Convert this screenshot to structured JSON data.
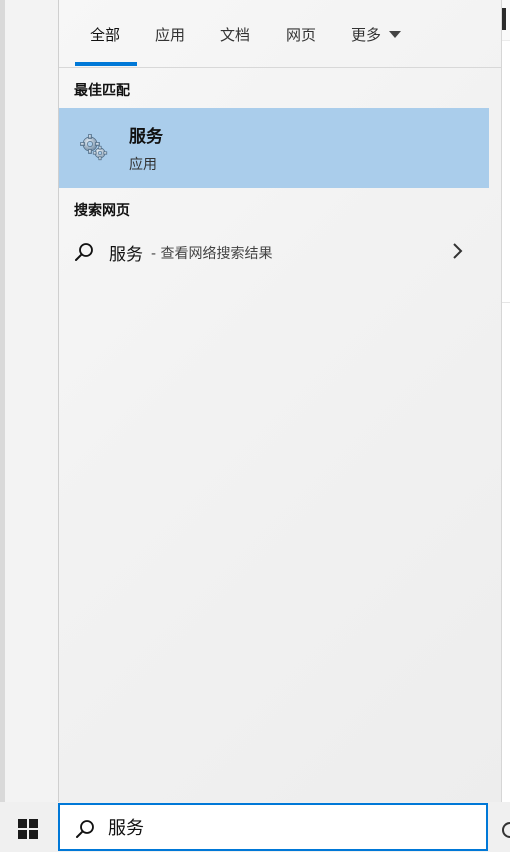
{
  "tabs": [
    {
      "label": "全部"
    },
    {
      "label": "应用"
    },
    {
      "label": "文档"
    },
    {
      "label": "网页"
    },
    {
      "label": "更多"
    }
  ],
  "active_tab": "全部",
  "best_match": {
    "section_label": "最佳匹配",
    "name": "服务",
    "type": "应用",
    "icon": "services-gear-icon"
  },
  "web_search": {
    "section_label": "搜索网页",
    "query": "服务",
    "hint": "- 查看网络搜索结果",
    "icon": "search-icon"
  },
  "search_box": {
    "value": "服务",
    "icon": "search-icon"
  },
  "colors": {
    "accent": "#0078d7",
    "selection": "#aacdeb",
    "panel": "#f2f2f2",
    "taskbar": "#f0f0f0"
  }
}
